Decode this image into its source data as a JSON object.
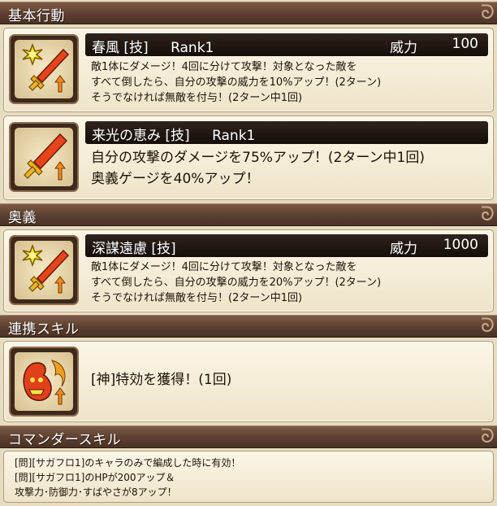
{
  "sections": {
    "basic": "基本行動",
    "ougi": "奥義",
    "renkei": "連携スキル",
    "commander": "コマンダースキル"
  },
  "skills": [
    {
      "name": "春風 [技]",
      "rank": "Rank1",
      "power_label": "威力",
      "power_value": "100",
      "lines": [
        "敵1体にダメージ！4回に分けて攻撃！対象となった敵を",
        "すべて倒したら、自分の攻撃の威力を10%アップ！(2ターン)",
        "そうでなければ無敵を付与！(2ターン中1回)"
      ],
      "icon": "sword-burst-icon"
    },
    {
      "name": "来光の恵み [技]",
      "rank": "Rank1",
      "lines": [
        "自分の攻撃のダメージを75%アップ！(2ターン中1回)",
        "奥義ゲージを40%アップ！"
      ],
      "icon": "sword-up-icon"
    },
    {
      "name": "深謀遠慮 [技]",
      "power_label": "威力",
      "power_value": "1000",
      "lines": [
        "敵1体にダメージ！4回に分けて攻撃！対象となった敵を",
        "すべて倒したら、自分の攻撃の威力を20%アップ！(2ターン)",
        "そうでなければ無敵を付与！(2ターン中1回)"
      ],
      "icon": "sword-burst-icon"
    }
  ],
  "link_skill": {
    "text": "[神]特効を獲得！(1回)",
    "icon": "demon-flame-icon"
  },
  "commander": {
    "lines": [
      "[問][サガフロ1]のキャラのみで編成した時に有効！",
      "[問][サガフロ1]のHPが200アップ＆",
      "攻撃力･防御力･すばやさが8アップ！"
    ]
  },
  "colors": {
    "header": "#5b3f30",
    "skill_bar": "#1c130e",
    "card": "#f5eedb"
  }
}
